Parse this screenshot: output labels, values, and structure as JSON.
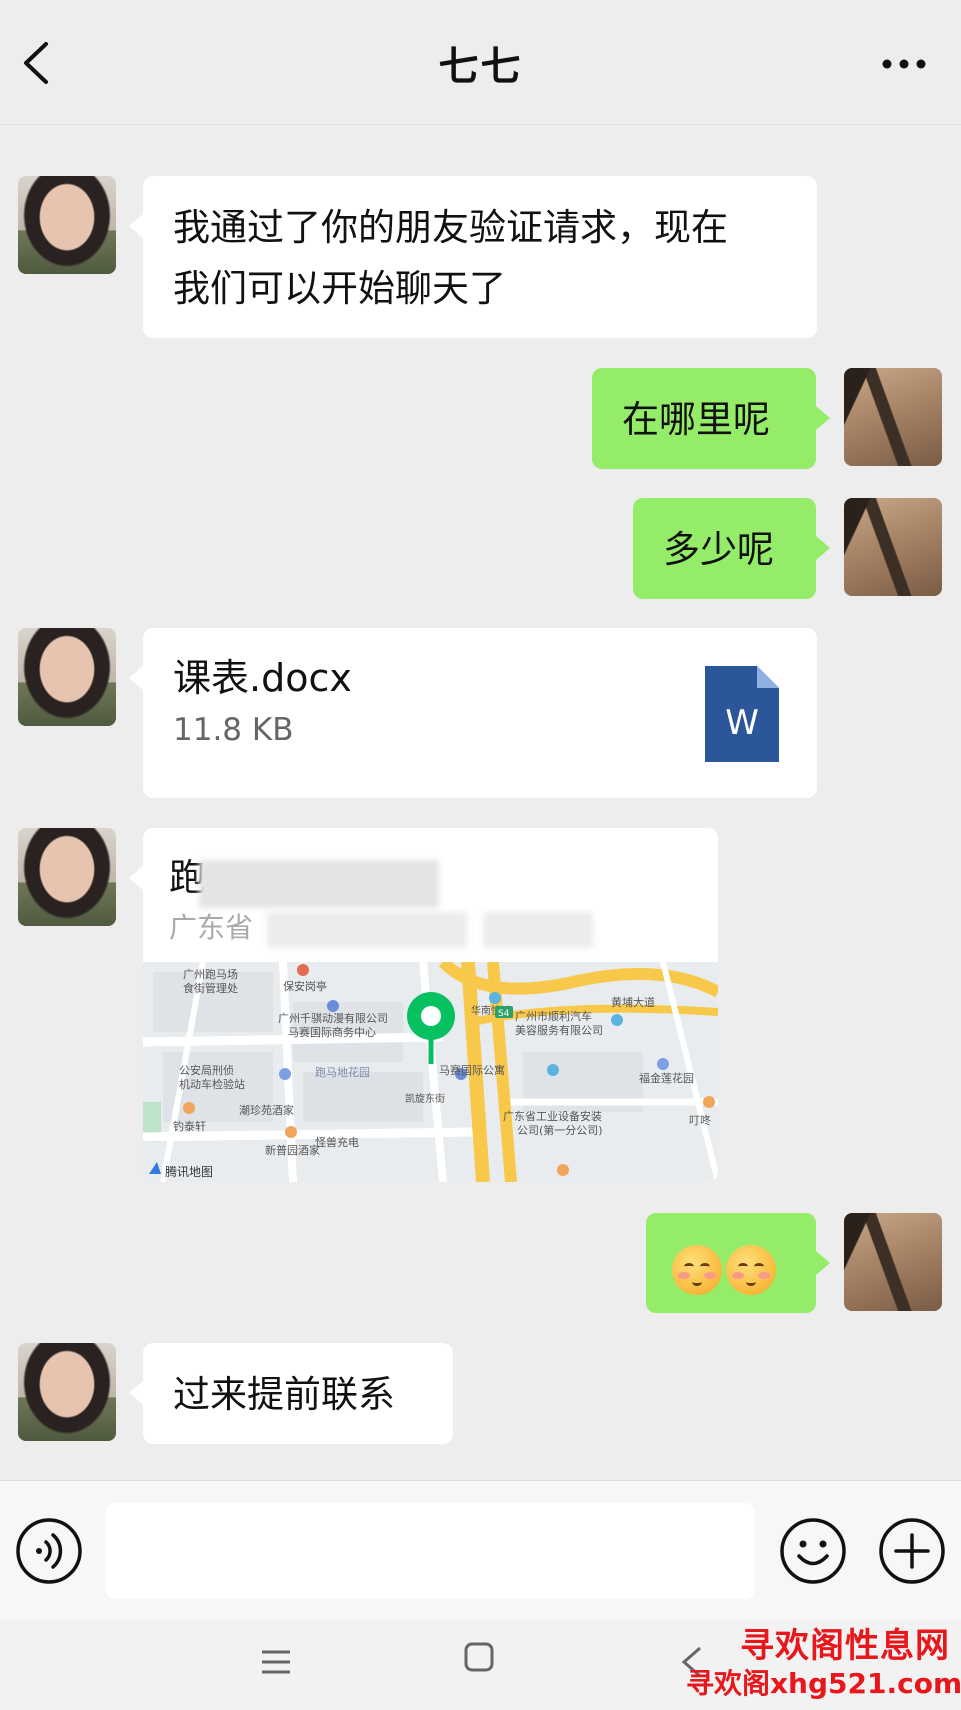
{
  "header": {
    "title": "七七"
  },
  "messages": [
    {
      "from": "七七",
      "type": "text",
      "lines": [
        "我通过了你的朋友验证请求，现在",
        "我们可以开始聊天了"
      ]
    },
    {
      "from": "me",
      "type": "text",
      "text": "在哪里呢"
    },
    {
      "from": "me",
      "type": "text",
      "text": "多少呢"
    },
    {
      "from": "七七",
      "type": "file",
      "file_name": "课表.docx",
      "file_size": "11.8 KB",
      "icon_letter": "W"
    },
    {
      "from": "七七",
      "type": "location",
      "title": "跑",
      "address": "广东省",
      "map_credit": "腾讯地图",
      "map_labels": [
        "广州跑马场",
        "食街管理处",
        "保安岗亭",
        "广州千骐动漫有限公司",
        "马赛国际商务中心",
        "公安局刑侦",
        "机动车检验站",
        "跑马地花园",
        "潮珍苑酒家",
        "钓泰轩",
        "新普园酒家",
        "怪兽充电",
        "马赛国际公寓",
        "凯旋东街",
        "华南快速",
        "黄埔大道",
        "广州市顺利汽车",
        "美容服务有限公司",
        "福金莲花园",
        "广东省工业设备安装",
        "公司(第一分公司)",
        "叮咚",
        "S4"
      ]
    },
    {
      "from": "me",
      "type": "emoji",
      "emoji_count": 2,
      "emoji_name": "blushing-face"
    },
    {
      "from": "七七",
      "type": "text",
      "text": "过来提前联系"
    }
  ],
  "input": {
    "value": "",
    "placeholder": ""
  },
  "watermark": {
    "line1": "寻欢阁性息网",
    "line2": "寻欢阁xhg521.com"
  },
  "colors": {
    "background": "#ededed",
    "outgoing_bubble": "#95ec69",
    "incoming_bubble": "#ffffff",
    "word_icon": "#2b579a",
    "map_pin": "#07c160",
    "watermark": "#e8171c"
  }
}
